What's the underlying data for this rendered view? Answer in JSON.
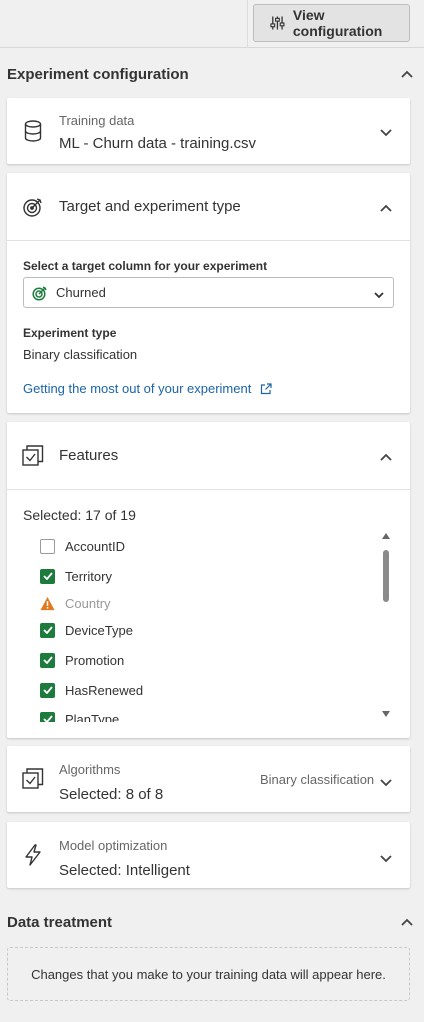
{
  "toolbar": {
    "view_configuration_label": "View configuration"
  },
  "experiment_configuration": {
    "title": "Experiment configuration"
  },
  "training_data": {
    "label": "Training data",
    "value": "ML - Churn data - training.csv"
  },
  "target": {
    "title": "Target and experiment type",
    "select_label": "Select a target column for your experiment",
    "selected_column": "Churned",
    "experiment_type_label": "Experiment type",
    "experiment_type_value": "Binary classification",
    "help_link": "Getting the most out of your experiment"
  },
  "features": {
    "title": "Features",
    "selected_text": "Selected: 17 of 19",
    "items": [
      {
        "name": "AccountID",
        "state": "unchecked"
      },
      {
        "name": "Territory",
        "state": "checked"
      },
      {
        "name": "Country",
        "state": "warning"
      },
      {
        "name": "DeviceType",
        "state": "checked"
      },
      {
        "name": "Promotion",
        "state": "checked"
      },
      {
        "name": "HasRenewed",
        "state": "checked"
      },
      {
        "name": "PlanType",
        "state": "checked"
      }
    ]
  },
  "algorithms": {
    "label": "Algorithms",
    "value": "Selected: 8 of 8",
    "type": "Binary classification"
  },
  "model_optimization": {
    "label": "Model optimization",
    "value": "Selected: Intelligent"
  },
  "data_treatment": {
    "title": "Data treatment",
    "placeholder_text": "Changes that you make to your training data will appear here."
  },
  "colors": {
    "accent_green": "#1e7b3e",
    "link_blue": "#1b64a6",
    "warning_orange": "#e07a1f"
  }
}
